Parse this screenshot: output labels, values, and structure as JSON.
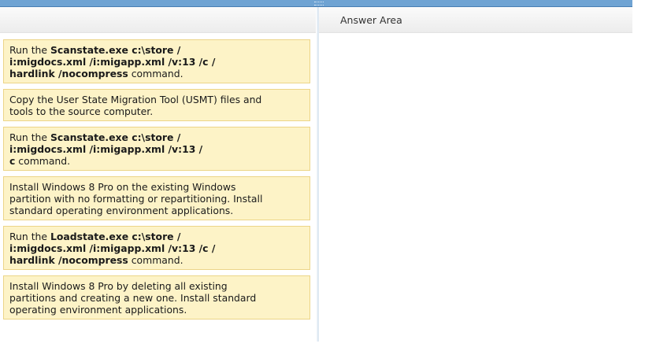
{
  "answer_area": {
    "title": "Answer Area"
  },
  "items": [
    {
      "parts": [
        {
          "text": "Run the ",
          "bold": false
        },
        {
          "text": "Scanstate.exe c:\\store / i:migdocs.xml /i:migapp.xml /v:13 /c / hardlink /nocompress",
          "bold": true
        },
        {
          "text": " command.",
          "bold": false
        }
      ],
      "lines": [
        [
          {
            "text": "Run the ",
            "bold": false
          },
          {
            "text": "Scanstate.exe c:\\store /",
            "bold": true
          }
        ],
        [
          {
            "text": "i:migdocs.xml /i:migapp.xml /v:13 /c /",
            "bold": true
          }
        ],
        [
          {
            "text": "hardlink /nocompress",
            "bold": true
          },
          {
            "text": " command.",
            "bold": false
          }
        ]
      ]
    },
    {
      "lines": [
        [
          {
            "text": "Copy the User State Migration Tool (USMT) files and",
            "bold": false
          }
        ],
        [
          {
            "text": "tools to the source computer.",
            "bold": false
          }
        ]
      ]
    },
    {
      "lines": [
        [
          {
            "text": "Run the ",
            "bold": false
          },
          {
            "text": "Scanstate.exe c:\\store /",
            "bold": true
          }
        ],
        [
          {
            "text": "i:migdocs.xml /i:migapp.xml /v:13 /",
            "bold": true
          }
        ],
        [
          {
            "text": "c",
            "bold": true
          },
          {
            "text": " command.",
            "bold": false
          }
        ]
      ]
    },
    {
      "lines": [
        [
          {
            "text": "Install Windows 8 Pro on the existing Windows",
            "bold": false
          }
        ],
        [
          {
            "text": "partition with no formatting or repartitioning. Install",
            "bold": false
          }
        ],
        [
          {
            "text": "standard operating environment applications.",
            "bold": false
          }
        ]
      ]
    },
    {
      "lines": [
        [
          {
            "text": "Run the ",
            "bold": false
          },
          {
            "text": "Loadstate.exe c:\\store /",
            "bold": true
          }
        ],
        [
          {
            "text": "i:migdocs.xml /i:migapp.xml /v:13 /c /",
            "bold": true
          }
        ],
        [
          {
            "text": "hardlink /nocompress",
            "bold": true
          },
          {
            "text": " command.",
            "bold": false
          }
        ]
      ]
    },
    {
      "lines": [
        [
          {
            "text": "Install Windows 8 Pro by deleting all existing",
            "bold": false
          }
        ],
        [
          {
            "text": "partitions and creating a new one. Install standard",
            "bold": false
          }
        ],
        [
          {
            "text": "operating environment applications.",
            "bold": false
          }
        ]
      ]
    }
  ]
}
